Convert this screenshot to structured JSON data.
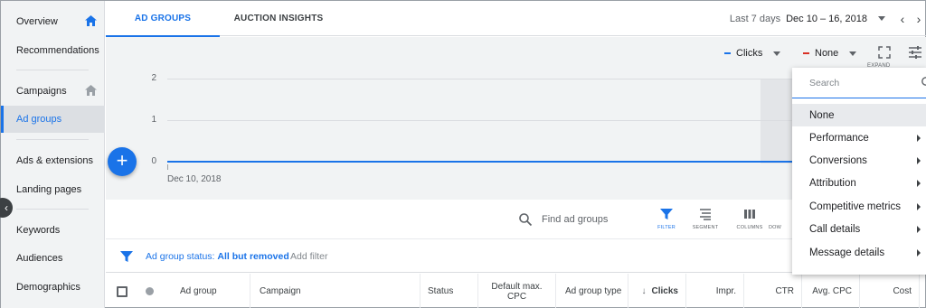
{
  "sidebar": {
    "items": [
      {
        "label": "Overview"
      },
      {
        "label": "Recommendations"
      },
      {
        "label": "Campaigns"
      },
      {
        "label": "Ad groups"
      },
      {
        "label": "Ads & extensions"
      },
      {
        "label": "Landing pages"
      },
      {
        "label": "Keywords"
      },
      {
        "label": "Audiences"
      },
      {
        "label": "Demographics"
      }
    ],
    "active_item": "Ad groups"
  },
  "tabs": [
    {
      "label": "AD GROUPS"
    },
    {
      "label": "AUCTION INSIGHTS"
    }
  ],
  "date_range": {
    "label": "Last 7 days",
    "value": "Dec 10 – 16, 2018"
  },
  "chart_controls": {
    "metric1": {
      "label": "Clicks",
      "color": "#1a73e8"
    },
    "metric2": {
      "label": "None",
      "color": "#d93025"
    },
    "expand_label": "EXPAND"
  },
  "chart_data": {
    "type": "line",
    "x": [
      "Dec 10, 2018"
    ],
    "series": [
      {
        "values": [
          0
        ]
      }
    ],
    "y_ticks": [
      "2",
      "1",
      "0"
    ],
    "ylim": [
      0,
      2
    ],
    "grid": true
  },
  "toolbar": {
    "search_placeholder": "Find ad groups",
    "buttons": [
      {
        "label": "FILTER"
      },
      {
        "label": "SEGMENT"
      },
      {
        "label": "COLUMNS"
      },
      {
        "label": "DOW"
      }
    ]
  },
  "filter": {
    "prefix": "Ad group status: ",
    "value": "All but removed",
    "add_label": "Add filter"
  },
  "table": {
    "columns": [
      {
        "label": "Ad group"
      },
      {
        "label": "Campaign"
      },
      {
        "label": "Status"
      },
      {
        "label": "Default max. CPC"
      },
      {
        "label": "Ad group type"
      },
      {
        "label": "Clicks"
      },
      {
        "label": "Impr."
      },
      {
        "label": "CTR"
      },
      {
        "label": "Avg. CPC"
      },
      {
        "label": "Cost"
      }
    ],
    "sort_arrow": "↓"
  },
  "menu": {
    "search_placeholder": "Search",
    "items": [
      {
        "label": "None"
      },
      {
        "label": "Performance"
      },
      {
        "label": "Conversions"
      },
      {
        "label": "Attribution"
      },
      {
        "label": "Competitive metrics"
      },
      {
        "label": "Call details"
      },
      {
        "label": "Message details"
      }
    ],
    "selected": "None"
  }
}
